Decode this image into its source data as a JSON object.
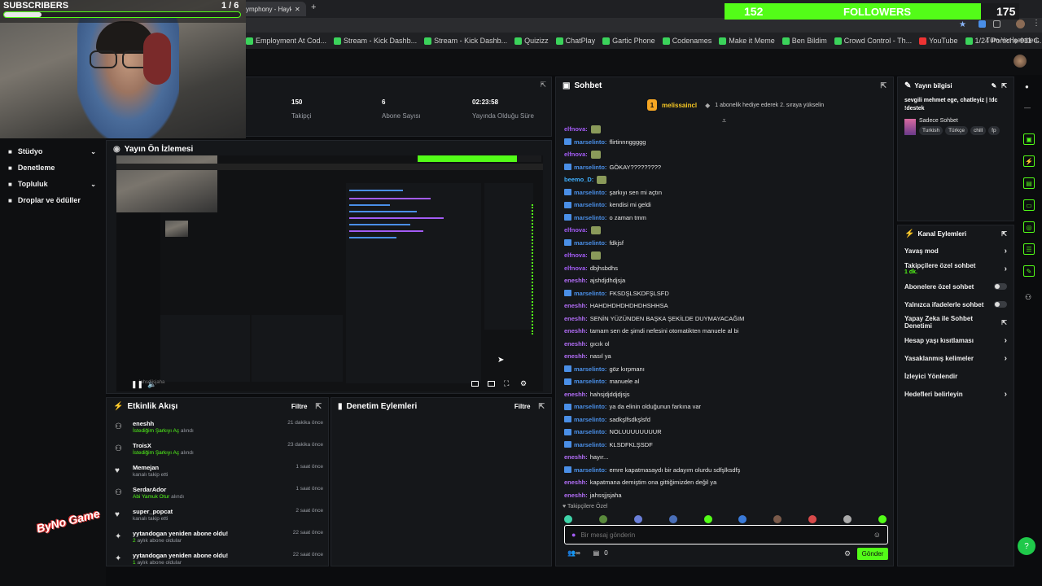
{
  "overlay": {
    "subscribers_label": "SUBSCRIBERS",
    "subscribers_count": "1 / 6",
    "subscribers_progress": 0.16,
    "followers_count": "152",
    "followers_label": "FOLLOWERS",
    "followers_goal": "175",
    "followers_progress": 0.87
  },
  "browser": {
    "active_tab": "ymphony - Hayko Ce",
    "bookmarks": [
      "Employment At Cod...",
      "Stream - Kick Dashb...",
      "Stream - Kick Dashb...",
      "Quizizz",
      "ChatPlay",
      "Gartic Phone",
      "Codenames",
      "Make it Meme",
      "Ben Bildim",
      "Crowd Control - Th...",
      "YouTube",
      "1/24 Porsche 911 G..."
    ],
    "all_bookmarks": "Tüm Yer İşaretleri"
  },
  "stats": [
    {
      "value": "150",
      "label": "Takipçi"
    },
    {
      "value": "6",
      "label": "Abone Sayısı"
    },
    {
      "value": "02:23:58",
      "label": "Yayında Olduğu Süre"
    }
  ],
  "nav": {
    "items": [
      {
        "label": "Stüdyo",
        "icon": "camera-icon",
        "expand": true
      },
      {
        "label": "Denetleme",
        "icon": "wrench-icon",
        "expand": false
      },
      {
        "label": "Topluluk",
        "icon": "users-icon",
        "expand": true
      },
      {
        "label": "Droplar ve ödüller",
        "icon": "gift-icon",
        "expand": false
      }
    ]
  },
  "preview": {
    "title": "Yayın Ön İzlemesi",
    "overlay_name": "jahsdjjsjaha"
  },
  "activity": {
    "title": "Etkinlik Akışı",
    "filter": "Filtre",
    "items": [
      {
        "name": "eneshh",
        "detail": "İstediğim Şarkıyı Aç",
        "suffix": "alındı",
        "time": "21 dakika önce",
        "icon": "gift-icon"
      },
      {
        "name": "TroisX",
        "detail": "İstediğim Şarkıyı Aç",
        "suffix": "alındı",
        "time": "23 dakika önce",
        "icon": "gift-icon"
      },
      {
        "name": "Memejan",
        "detail": "kanalı takip etti",
        "suffix": "",
        "time": "1 saat önce",
        "icon": "heart-icon"
      },
      {
        "name": "SerdarAdor",
        "detail": "Abi Yamuk Otur",
        "suffix": "alındı",
        "time": "1 saat önce",
        "icon": "gift-icon"
      },
      {
        "name": "super_popcat",
        "detail": "kanalı takip etti",
        "suffix": "",
        "time": "2 saat önce",
        "icon": "heart-icon"
      },
      {
        "name": "yytandogan yeniden abone oldu!",
        "detail": "2",
        "suffix": "aylık abone oldular",
        "time": "22 saat önce",
        "icon": "star-icon"
      },
      {
        "name": "yytandogan yeniden abone oldu!",
        "detail": "1",
        "suffix": "aylık abone oldular",
        "time": "22 saat önce",
        "icon": "star-icon"
      }
    ]
  },
  "moderation": {
    "title": "Denetim Eylemleri",
    "filter": "Filtre"
  },
  "chat": {
    "title": "Sohbet",
    "pinned_user": "melissaincl",
    "pinned_badge": "1",
    "pinned_text": "1 abonelik hediye ederek 2. sıraya yükselin",
    "messages": [
      {
        "user": "elfnova:",
        "text": "",
        "cls": "u2",
        "badge": false,
        "emote": true
      },
      {
        "user": "marselinto:",
        "text": "flirtinnnggggg",
        "cls": "u1",
        "badge": true,
        "emote": false
      },
      {
        "user": "elfnova:",
        "text": "",
        "cls": "u2",
        "badge": false,
        "emote": true
      },
      {
        "user": "marselinto:",
        "text": "GÖKAY?????????",
        "cls": "u1",
        "badge": true,
        "emote": false
      },
      {
        "user": "beemo_D:",
        "text": "",
        "cls": "u3",
        "badge": false,
        "emote": true
      },
      {
        "user": "marselinto:",
        "text": "şarkıyı sen mi açtın",
        "cls": "u1",
        "badge": true,
        "emote": false
      },
      {
        "user": "marselinto:",
        "text": "kendisi mi geldi",
        "cls": "u1",
        "badge": true,
        "emote": false
      },
      {
        "user": "marselinto:",
        "text": "o zaman tmm",
        "cls": "u1",
        "badge": true,
        "emote": false
      },
      {
        "user": "elfnova:",
        "text": "",
        "cls": "u2",
        "badge": false,
        "emote": true
      },
      {
        "user": "marselinto:",
        "text": "fdkjsf",
        "cls": "u1",
        "badge": true,
        "emote": false
      },
      {
        "user": "elfnova:",
        "text": "",
        "cls": "u2",
        "badge": false,
        "emote": true
      },
      {
        "user": "elfnova:",
        "text": "dbjhsbdhs",
        "cls": "u2",
        "badge": false,
        "emote": false
      },
      {
        "user": "eneshh:",
        "text": "ajshdjdhdjsja",
        "cls": "u4",
        "badge": false,
        "emote": false
      },
      {
        "user": "marselinto:",
        "text": "FKSDŞLSKDFŞLSFD",
        "cls": "u1",
        "badge": true,
        "emote": false
      },
      {
        "user": "eneshh:",
        "text": "HAHDHDHDHDHDHSHHSA",
        "cls": "u4",
        "badge": false,
        "emote": false
      },
      {
        "user": "eneshh:",
        "text": "SENİN YÜZÜNDEN BAŞKA ŞEKİLDE DUYMAYACAĞIM",
        "cls": "u4",
        "badge": false,
        "emote": false
      },
      {
        "user": "eneshh:",
        "text": "tamam sen de şimdi nefesini otomatikten manuele al bi",
        "cls": "u4",
        "badge": false,
        "emote": false
      },
      {
        "user": "eneshh:",
        "text": "gıcık ol",
        "cls": "u4",
        "badge": false,
        "emote": false
      },
      {
        "user": "eneshh:",
        "text": "nasıl ya",
        "cls": "u4",
        "badge": false,
        "emote": false
      },
      {
        "user": "marselinto:",
        "text": "göz kırpmanı",
        "cls": "u1",
        "badge": true,
        "emote": false
      },
      {
        "user": "marselinto:",
        "text": "manuele al",
        "cls": "u1",
        "badge": true,
        "emote": false
      },
      {
        "user": "eneshh:",
        "text": "hahsjdjddjdjsjs",
        "cls": "u4",
        "badge": false,
        "emote": false
      },
      {
        "user": "marselinto:",
        "text": "ya da elinin olduğunun farkına var",
        "cls": "u1",
        "badge": true,
        "emote": false
      },
      {
        "user": "marselinto:",
        "text": "sadkşlfsdkşlsfd",
        "cls": "u1",
        "badge": true,
        "emote": false
      },
      {
        "user": "marselinto:",
        "text": "NOLUUUUUUUUR",
        "cls": "u1",
        "badge": true,
        "emote": false
      },
      {
        "user": "marselinto:",
        "text": "KLSDFKLŞSDF",
        "cls": "u1",
        "badge": true,
        "emote": false
      },
      {
        "user": "eneshh:",
        "text": "hayır...",
        "cls": "u4",
        "badge": false,
        "emote": false
      },
      {
        "user": "marselinto:",
        "text": "emre kapatmasaydı bir adayım olurdu sdfşlksdfş",
        "cls": "u1",
        "badge": true,
        "emote": false
      },
      {
        "user": "eneshh:",
        "text": "kapatmana demiştim ona gittiğimizden değil ya",
        "cls": "u4",
        "badge": false,
        "emote": false
      },
      {
        "user": "eneshh:",
        "text": "jahssjjsjaha",
        "cls": "u4",
        "badge": false,
        "emote": false
      }
    ],
    "followers_only": "Takipçilere Özel",
    "input_placeholder": "Bir mesaj gönderin",
    "points": "0",
    "send": "Gönder"
  },
  "stream_info": {
    "title": "Yayın bilgisi",
    "stream_title": "sevgili mehmet ege, chatleyiz | !dc !destek",
    "category": "Sadece Sohbet",
    "tags": [
      "Turkish",
      "Türkçe",
      "chill",
      "fp"
    ]
  },
  "channel_actions": {
    "title": "Kanal Eylemleri",
    "items": [
      {
        "label": "Yavaş mod",
        "sub": "",
        "control": "arrow"
      },
      {
        "label": "Takipçilere özel sohbet",
        "sub": "1 dk.",
        "control": "arrow"
      },
      {
        "label": "Abonelere özel sohbet",
        "sub": "",
        "control": "toggle"
      },
      {
        "label": "Yalnızca ifadelerle sohbet",
        "sub": "",
        "control": "toggle"
      },
      {
        "label": "Yapay Zeka ile Sohbet Denetimi",
        "sub": "",
        "control": "link"
      },
      {
        "label": "Hesap yaşı kısıtlaması",
        "sub": "",
        "control": "arrow"
      },
      {
        "label": "Yasaklanmış kelimeler",
        "sub": "",
        "control": "arrow"
      },
      {
        "label": "İzleyici Yönlendir",
        "sub": "",
        "control": "none"
      },
      {
        "label": "Hedefleri belirleyin",
        "sub": "",
        "control": "arrow"
      }
    ]
  },
  "logo": {
    "text": "ByNo Game"
  },
  "colors": {
    "accent": "#53fc18",
    "bg": "#0b0c0e",
    "panel": "#15171a"
  }
}
